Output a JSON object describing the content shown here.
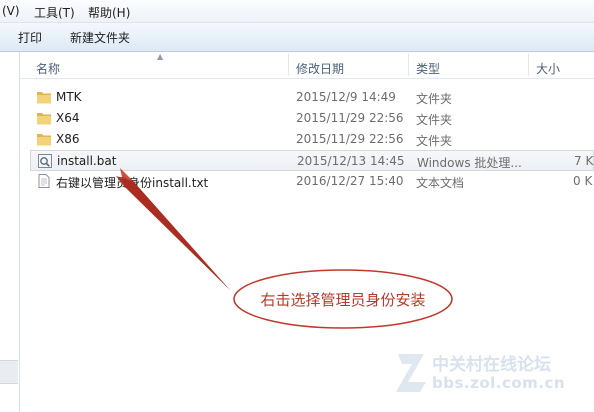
{
  "menubar": {
    "items": [
      {
        "label": "(V)"
      },
      {
        "label": "工具(T)"
      },
      {
        "label": "帮助(H)"
      }
    ]
  },
  "toolbar": {
    "print_label": "打印",
    "new_folder_label": "新建文件夹"
  },
  "columns": {
    "name": "名称",
    "date": "修改日期",
    "type": "类型",
    "size": "大小"
  },
  "files": [
    {
      "name": "MTK",
      "date": "2015/12/9 14:49",
      "type": "文件夹",
      "size": "",
      "icon": "folder-icon"
    },
    {
      "name": "X64",
      "date": "2015/11/29 22:56",
      "type": "文件夹",
      "size": "",
      "icon": "folder-icon"
    },
    {
      "name": "X86",
      "date": "2015/11/29 22:56",
      "type": "文件夹",
      "size": "",
      "icon": "folder-icon"
    },
    {
      "name": "install.bat",
      "date": "2015/12/13 14:45",
      "type": "Windows 批处理...",
      "size": "7 K",
      "icon": "batch-file-icon",
      "selected": true
    },
    {
      "name": "右键以管理员身份install.txt",
      "date": "2016/12/27 15:40",
      "type": "文本文档",
      "size": "0 K",
      "icon": "text-file-icon"
    }
  ],
  "annotation": {
    "text": "右击选择管理员身份安装",
    "color": "#c0392b"
  },
  "watermark": {
    "title": "中关村在线论坛",
    "url": "bbs.zol.com.cn"
  },
  "colors": {
    "folder": "#e8c25a",
    "selection": "#eceff3",
    "annotation": "#c0392b"
  }
}
